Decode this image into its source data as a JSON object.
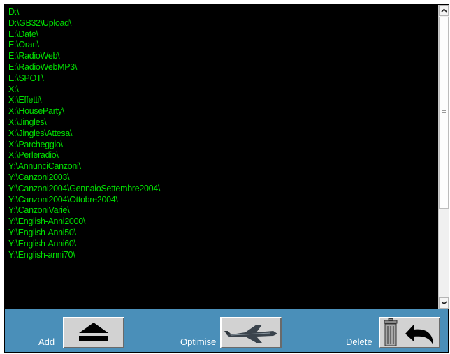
{
  "paths": [
    "D:\\",
    "D:\\GB32\\Upload\\",
    "E:\\Date\\",
    "E:\\Orari\\",
    "E:\\RadioWeb\\",
    "E:\\RadioWebMP3\\",
    "E:\\SPOT\\",
    "X:\\",
    "X:\\Effetti\\",
    "X:\\HouseParty\\",
    "X:\\Jingles\\",
    "X:\\Jingles\\Attesa\\",
    "X:\\Parcheggio\\",
    "X:\\Perleradio\\",
    "Y:\\AnnunciCanzoni\\",
    "Y:\\Canzoni2003\\",
    "Y:\\Canzoni2004\\GennaioSettembre2004\\",
    "Y:\\Canzoni2004\\Ottobre2004\\",
    "Y:\\CanzoniVarie\\",
    "Y:\\English-Anni2000\\",
    "Y:\\English-Anni50\\",
    "Y:\\English-Anni60\\",
    "Y:\\English-anni70\\"
  ],
  "toolbar": {
    "add_label": "Add",
    "optimise_label": "Optimise",
    "delete_label": "Delete"
  },
  "colors": {
    "list_background": "#000000",
    "list_text": "#00e000",
    "toolbar_background": "#4a8fb9",
    "toolbar_text": "#ffffff"
  },
  "icons": {
    "scroll_up": "chevron-up-icon",
    "scroll_down": "chevron-down-icon",
    "add": "eject-icon",
    "optimise": "jet-plane-icon",
    "delete": "trash-undo-icon"
  }
}
